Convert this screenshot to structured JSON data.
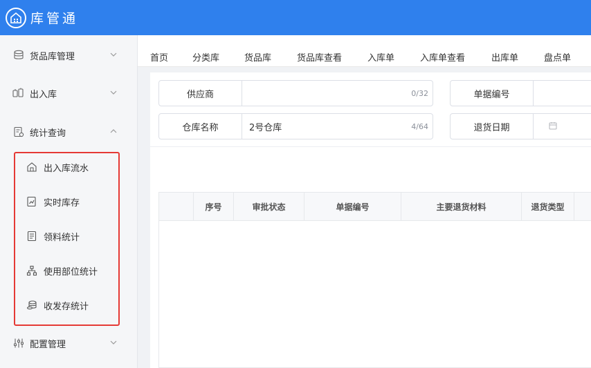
{
  "app": {
    "title": "库管通"
  },
  "sidebar": {
    "groups": [
      {
        "label": "货品库管理",
        "icon": "database-icon"
      },
      {
        "label": "出入库",
        "icon": "exchange-icon"
      },
      {
        "label": "统计查询",
        "icon": "report-icon",
        "items": [
          {
            "label": "出入库流水",
            "icon": "warehouse-icon"
          },
          {
            "label": "实时库存",
            "icon": "inventory-icon"
          },
          {
            "label": "领料统计",
            "icon": "document-icon"
          },
          {
            "label": "使用部位统计",
            "icon": "org-chart-icon"
          },
          {
            "label": "收发存统计",
            "icon": "coins-icon"
          }
        ]
      },
      {
        "label": "配置管理",
        "icon": "settings-sliders-icon"
      }
    ]
  },
  "tabs": [
    "首页",
    "分类库",
    "货品库",
    "货品库查看",
    "入库单",
    "入库单查看",
    "出库单",
    "盘点单"
  ],
  "form": {
    "supplier": {
      "label": "供应商",
      "value": "",
      "count": "0/32"
    },
    "doc_no": {
      "label": "单据编号",
      "value": ""
    },
    "warehouse": {
      "label": "仓库名称",
      "value": "2号仓库",
      "count": "4/64"
    },
    "return_date": {
      "label": "退货日期",
      "value": ""
    }
  },
  "table": {
    "columns": [
      "",
      "序号",
      "审批状态",
      "单据编号",
      "主要退货材料",
      "退货类型"
    ],
    "rows": []
  },
  "colors": {
    "topbar": "#2f80ed",
    "highlight": "#e53935"
  }
}
